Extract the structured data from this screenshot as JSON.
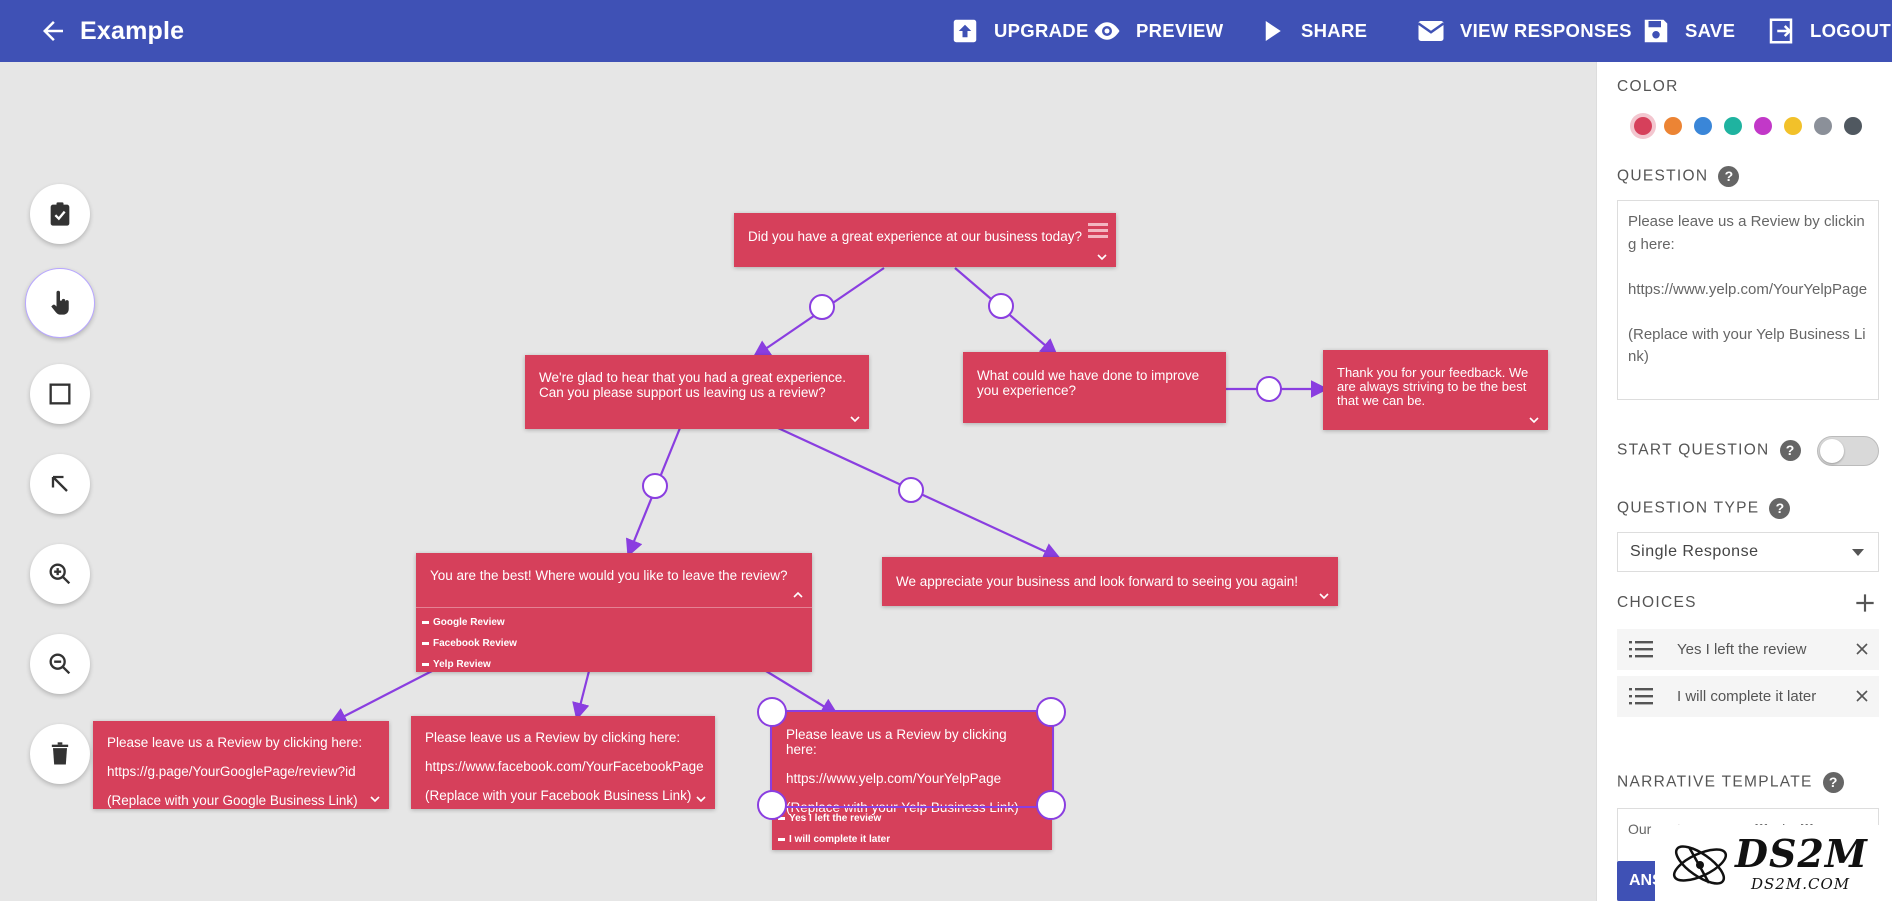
{
  "header": {
    "title": "Example",
    "buttons": {
      "upgrade": "UPGRADE",
      "preview": "PREVIEW",
      "share": "SHARE",
      "view_responses": "VIEW RESPONSES",
      "save": "SAVE",
      "logout": "LOGOUT"
    }
  },
  "nodes": {
    "n1": {
      "question": "Did you have a great experience at our business today?"
    },
    "n2": {
      "question": "We're glad to hear that you had a great experience. Can you please support us leaving us a review?"
    },
    "n3": {
      "question": "What could we have done to improve you experience?"
    },
    "n4": {
      "question": "Thank you for your feedback. We are always striving to be the best that we can be."
    },
    "n5": {
      "question": "You are the best! Where would you like to leave the review?",
      "choices": [
        "Google Review",
        "Facebook Review",
        "Yelp Review"
      ]
    },
    "n6": {
      "question": "We appreciate your business and look forward to seeing you again!"
    },
    "n7": {
      "lines": [
        "Please leave us a Review by clicking here:",
        "https://g.page/YourGooglePage/review?id",
        "(Replace with your Google Business Link)"
      ]
    },
    "n8": {
      "lines": [
        "Please leave us a Review by clicking here:",
        "https://www.facebook.com/YourFacebookPage",
        "(Replace with your Facebook Business Link)"
      ]
    },
    "n9": {
      "lines": [
        "Please leave us a Review by clicking here:",
        "https://www.yelp.com/YourYelpPage",
        "(Replace with your Yelp Business Link)"
      ],
      "choices": [
        "Yes I left the review",
        "I will complete it later"
      ]
    }
  },
  "panel": {
    "color_label": "COLOR",
    "colors": [
      "#d6405b",
      "#ec8434",
      "#3a86d8",
      "#1fb3a0",
      "#c238c8",
      "#f2c12a",
      "#8b9099",
      "#505860"
    ],
    "question_label": "QUESTION",
    "question_text": "Please leave us a Review by clicking here:\n\nhttps://www.yelp.com/YourYelpPage\n\n(Replace with your Yelp Business Link)",
    "start_question_label": "START QUESTION",
    "question_type_label": "QUESTION TYPE",
    "question_type_value": "Single Response",
    "choices_label": "CHOICES",
    "choices": [
      "Yes I left the review",
      "I will complete it later"
    ],
    "narrative_label": "NARRATIVE TEMPLATE",
    "narrative_value": "Our customer says: {{{value}}}",
    "answer_button": "ANS"
  },
  "watermark": {
    "brand": "DS2M",
    "domain": "DS2M.COM"
  },
  "theme": {
    "header": "#3f51b5",
    "node": "#d6405b",
    "edge": "#8a3ee0"
  }
}
